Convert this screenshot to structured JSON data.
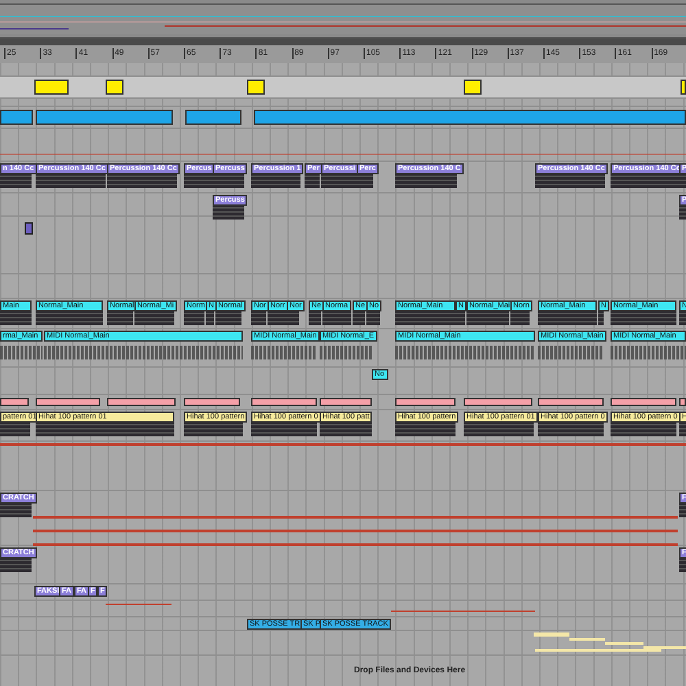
{
  "ruler": [
    "25",
    "33",
    "41",
    "49",
    "57",
    "65",
    "73",
    "81",
    "89",
    "97",
    "105",
    "113",
    "121",
    "129",
    "137",
    "145",
    "153",
    "161",
    "169"
  ],
  "tracks": [
    {
      "kind": "audio",
      "color": "#8c7fd9",
      "clips": [
        "n 140 Cc",
        "Percussion 140 Cc",
        "Percussion 140 Cc",
        "Percus",
        "Percuss",
        "Percussion 1",
        "Per",
        "Percussi",
        "Perc",
        "Percussion 140 C",
        "Percussion 140 Cc",
        "Percussion 140 Cc",
        "P"
      ]
    },
    {
      "kind": "audio",
      "color": "#8c7fd9",
      "clips": [
        "Percuss",
        "P"
      ]
    },
    {
      "kind": "audio",
      "color": "#3ee6f2",
      "clips": [
        "Main",
        "Normal_Main",
        "Normal",
        "Normal_Mi",
        "Norm",
        "N",
        "Normal",
        "Nor",
        "Norr",
        "Nor",
        "Ne",
        "Norma",
        "Ne",
        "No",
        "Normal_Main",
        "N",
        "Normal_Mai",
        "Norn",
        "Normal_Main",
        "N",
        "Normal_Main",
        "N"
      ]
    },
    {
      "kind": "midi",
      "color": "#3ee6f2",
      "clips": [
        "rmal_Main",
        "MIDI Normal_Main",
        "MIDI Normal_Main",
        "MIDI Normal_E",
        "MIDI Normal_Main",
        "MIDI Normal_Main",
        "MIDI Normal_Main"
      ]
    },
    {
      "kind": "plain",
      "color": "#3ee6f2",
      "clips": [
        "No"
      ]
    },
    {
      "kind": "audio",
      "color": "#f6ea9c",
      "clips": [
        "pattern 01",
        "Hihat 100 pattern 01",
        "Hihat 100 pattern",
        "Hihat 100 pattern 0",
        "Hihat 100 patt",
        "Hihat 100 pattern",
        "Hihat 100 pattern 01",
        "Hihat 100 pattern 0",
        "Hihat 100 pattern 0",
        "H"
      ]
    },
    {
      "kind": "audio",
      "color": "#8c7fd9",
      "clips": [
        "CRATCH",
        "F"
      ]
    },
    {
      "kind": "audio",
      "color": "#8c7fd9",
      "clips": [
        "CRATCH",
        "F"
      ]
    },
    {
      "kind": "plain",
      "color": "#8c7fd9",
      "clips": [
        "FAKSI",
        "FA",
        "FA",
        "F",
        "F"
      ]
    },
    {
      "kind": "plain",
      "color": "#34aee6",
      "clips": [
        "SK POSSE TR",
        "SK P",
        "SK POSSE TRACK"
      ]
    }
  ],
  "drop_hint": "Drop Files and Devices Here"
}
